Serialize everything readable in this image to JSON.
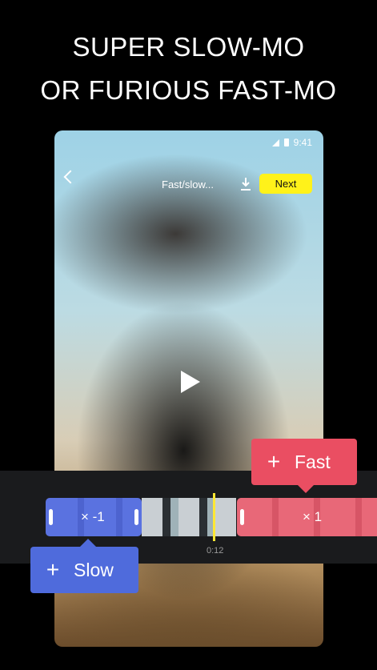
{
  "headline": {
    "line1": "SUPER SLOW-MO",
    "line2": "OR FURIOUS FAST-MO"
  },
  "status_bar": {
    "time": "9:41"
  },
  "editor": {
    "title": "Fast/slow...",
    "next_label": "Next",
    "icons": [
      "back-arrow-icon",
      "download-icon",
      "play-icon",
      "signal-icon",
      "battery-icon"
    ]
  },
  "timeline": {
    "slow_multiplier": "× -1",
    "fast_multiplier": "× 1",
    "timestamp": "0:12"
  },
  "bubbles": {
    "fast": {
      "plus": "+",
      "label": "Fast"
    },
    "slow": {
      "plus": "+",
      "label": "Slow"
    }
  },
  "colors": {
    "next": "#fff21a",
    "fast": "#ea4e62",
    "slow": "#4f6bdc",
    "playhead": "#ffe834"
  }
}
